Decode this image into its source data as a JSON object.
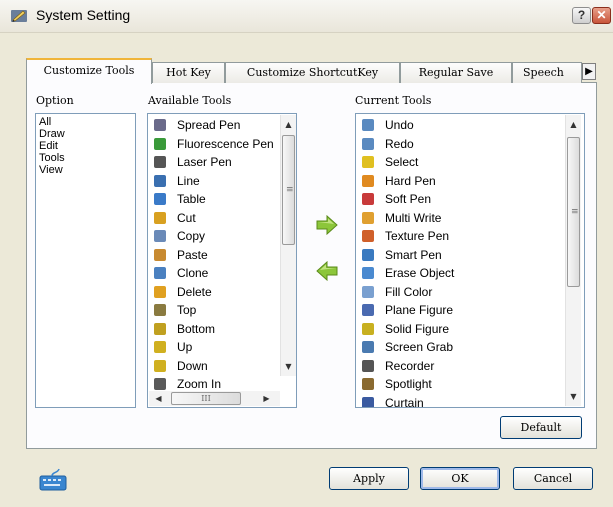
{
  "window": {
    "title": "System Setting",
    "help_glyph": "?",
    "close_glyph": "✕"
  },
  "tabs": [
    "Customize Tools",
    "Hot Key",
    "Customize ShortcutKey",
    "Regular Save",
    "Speech"
  ],
  "tab_scroll_glyph": "▶",
  "labels": {
    "option": "Option",
    "available": "Available Tools",
    "current": "Current Tools"
  },
  "options": [
    "All",
    "Draw",
    "Edit",
    "Tools",
    "View"
  ],
  "available_tools": [
    {
      "label": "Spread Pen",
      "icon": "spread-pen-icon",
      "color": "#6a6a8a"
    },
    {
      "label": "Fluorescence Pen",
      "icon": "fluorescence-pen-icon",
      "color": "#3a9a3a"
    },
    {
      "label": "Laser Pen",
      "icon": "laser-pen-icon",
      "color": "#555555"
    },
    {
      "label": "Line",
      "icon": "line-icon",
      "color": "#3a6fb0"
    },
    {
      "label": "Table",
      "icon": "table-icon",
      "color": "#3a7ac8"
    },
    {
      "label": "Cut",
      "icon": "scissors-icon",
      "color": "#d8a020"
    },
    {
      "label": "Copy",
      "icon": "copy-icon",
      "color": "#6a8ab8"
    },
    {
      "label": "Paste",
      "icon": "paste-icon",
      "color": "#c88a30"
    },
    {
      "label": "Clone",
      "icon": "clone-icon",
      "color": "#4a80c0"
    },
    {
      "label": "Delete",
      "icon": "delete-icon",
      "color": "#e0a020"
    },
    {
      "label": "Top",
      "icon": "top-icon",
      "color": "#8a7a40"
    },
    {
      "label": "Bottom",
      "icon": "bottom-icon",
      "color": "#c0a020"
    },
    {
      "label": "Up",
      "icon": "up-arrow-icon",
      "color": "#d0b020"
    },
    {
      "label": "Down",
      "icon": "down-arrow-icon",
      "color": "#d0b020"
    },
    {
      "label": "Zoom In",
      "icon": "zoom-in-icon",
      "color": "#5a5a5a"
    }
  ],
  "current_tools": [
    {
      "label": "Undo",
      "icon": "undo-icon",
      "color": "#5a8ac0"
    },
    {
      "label": "Redo",
      "icon": "redo-icon",
      "color": "#5a8ac0"
    },
    {
      "label": "Select",
      "icon": "select-icon",
      "color": "#e0c020"
    },
    {
      "label": "Hard Pen",
      "icon": "hard-pen-icon",
      "color": "#e08a20"
    },
    {
      "label": "Soft Pen",
      "icon": "soft-pen-icon",
      "color": "#c83a3a"
    },
    {
      "label": "Multi Write",
      "icon": "multi-write-icon",
      "color": "#e0a030"
    },
    {
      "label": "Texture Pen",
      "icon": "texture-pen-icon",
      "color": "#d0602a"
    },
    {
      "label": "Smart Pen",
      "icon": "smart-pen-icon",
      "color": "#3a7ac0"
    },
    {
      "label": "Erase Object",
      "icon": "erase-object-icon",
      "color": "#4a8ad0"
    },
    {
      "label": "Fill Color",
      "icon": "fill-color-icon",
      "color": "#7aa0d0"
    },
    {
      "label": "Plane Figure",
      "icon": "plane-figure-icon",
      "color": "#4a6ab0"
    },
    {
      "label": "Solid Figure",
      "icon": "solid-figure-icon",
      "color": "#c8b020"
    },
    {
      "label": "Screen Grab",
      "icon": "screen-grab-icon",
      "color": "#4a7ab0"
    },
    {
      "label": "Recorder",
      "icon": "recorder-icon",
      "color": "#555555"
    },
    {
      "label": "Spotlight",
      "icon": "spotlight-icon",
      "color": "#8a6a30"
    },
    {
      "label": "Curtain",
      "icon": "curtain-icon",
      "color": "#3a5aa0"
    }
  ],
  "scroll_glyphs": {
    "up": "▲",
    "down": "▼",
    "left": "◀",
    "right": "▶",
    "grip": "≡",
    "hgrip": "III"
  },
  "buttons": {
    "default": "Default",
    "apply": "Apply",
    "ok": "OK",
    "cancel": "Cancel"
  },
  "colors": {
    "arrow_green": "#7dbb2a",
    "tab_highlight": "#f0b53a"
  }
}
